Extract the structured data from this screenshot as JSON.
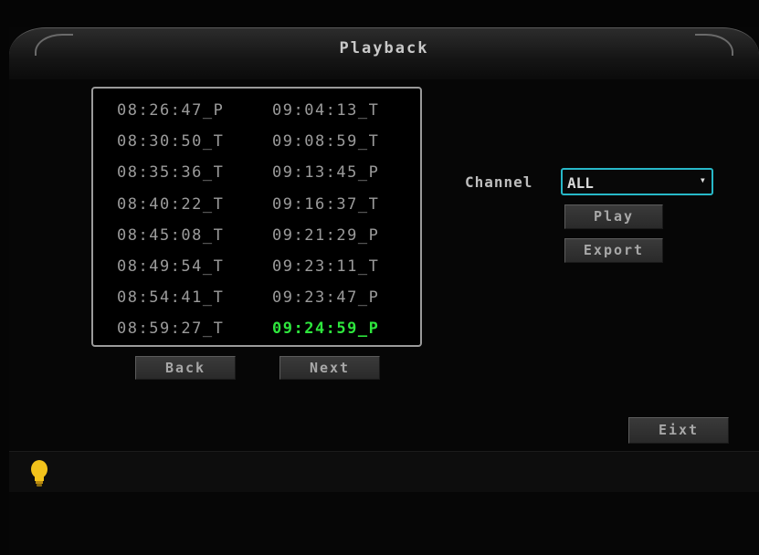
{
  "window": {
    "title": "Playback"
  },
  "file_list": {
    "items": [
      {
        "label": "08:26:47_P"
      },
      {
        "label": "08:30:50_T"
      },
      {
        "label": "08:35:36_T"
      },
      {
        "label": "08:40:22_T"
      },
      {
        "label": "08:45:08_T"
      },
      {
        "label": "08:49:54_T"
      },
      {
        "label": "08:54:41_T"
      },
      {
        "label": "08:59:27_T"
      },
      {
        "label": "09:04:13_T"
      },
      {
        "label": "09:08:59_T"
      },
      {
        "label": "09:13:45_P"
      },
      {
        "label": "09:16:37_T"
      },
      {
        "label": "09:21:29_P"
      },
      {
        "label": "09:23:11_T"
      },
      {
        "label": "09:23:47_P"
      },
      {
        "label": "09:24:59_P"
      }
    ],
    "selected": "09:24:59_P"
  },
  "pager": {
    "back_label": "Back",
    "next_label": "Next"
  },
  "channel": {
    "label": "Channel",
    "value": "ALL"
  },
  "actions": {
    "play_label": "Play",
    "export_label": "Export",
    "exit_label": "Eixt"
  },
  "colors": {
    "selected_text": "#2ee63d",
    "focus_border": "#27b8c8",
    "hint_icon": "#f2c21b"
  },
  "status_bar": {
    "icon": "lightbulb-icon"
  }
}
